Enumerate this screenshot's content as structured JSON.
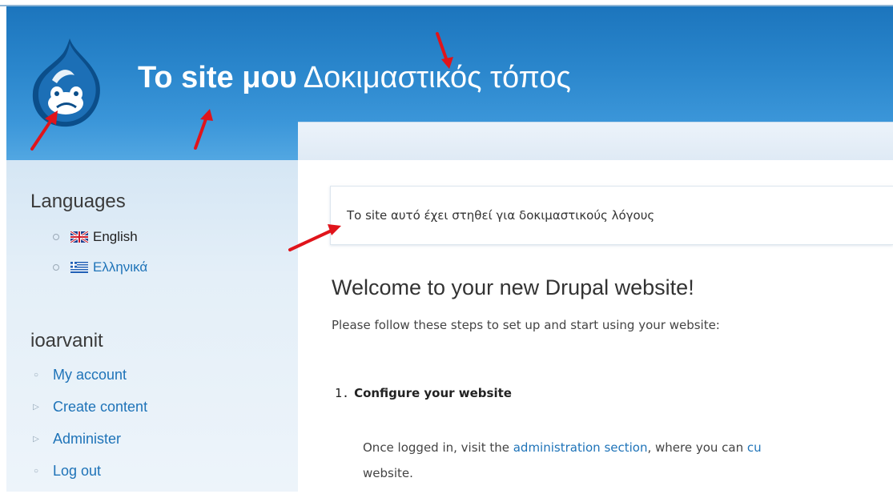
{
  "header": {
    "site_name": "Το site μου",
    "site_slogan": "Δοκιμαστικός τόπος",
    "logo_icon": "drupal-drop-logo-icon",
    "background_color": "#2a86cc"
  },
  "sidebar": {
    "languages_title": "Languages",
    "languages": [
      {
        "label": "English",
        "flag_icon": "uk-flag-icon"
      },
      {
        "label": "Ελληνικά",
        "flag_icon": "greece-flag-icon"
      }
    ],
    "user_title": "ioarvanit",
    "user_menu": [
      {
        "label": "My account",
        "marker": "circle"
      },
      {
        "label": "Create content",
        "marker": "triangle"
      },
      {
        "label": "Administer",
        "marker": "triangle"
      },
      {
        "label": "Log out",
        "marker": "circle"
      }
    ]
  },
  "main": {
    "mission": "Το site αυτό έχει στηθεί για δοκιμαστικούς λόγους",
    "welcome_title": "Welcome to your new Drupal website!",
    "welcome_sub": "Please follow these steps to set up and start using your website:",
    "step_number": "1.",
    "step_title": "Configure your website",
    "step_text_before": "Once logged in, visit the ",
    "step_link": "administration section",
    "step_text_after": ", where you can ",
    "step_link_cut": "cu",
    "step_text_line2": "website."
  },
  "colors": {
    "link": "#1e73b8",
    "annotation_arrow": "#e0141b"
  }
}
